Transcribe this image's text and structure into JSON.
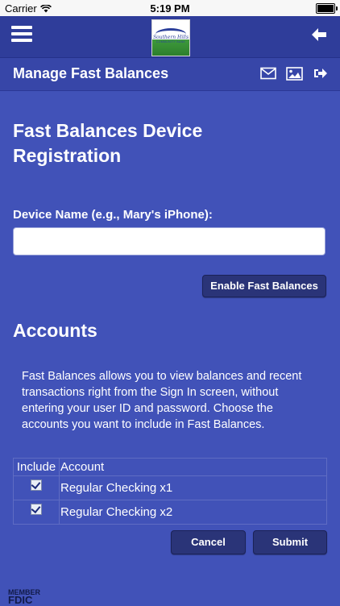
{
  "status_bar": {
    "carrier": "Carrier",
    "time": "5:19 PM"
  },
  "nav": {
    "logo": {
      "name": "Southern Hills",
      "sub": "COMMUNITY BANK"
    }
  },
  "title_bar": {
    "title": "Manage Fast Balances"
  },
  "registration": {
    "heading": "Fast Balances Device Registration",
    "device_label": "Device Name (e.g., Mary's iPhone):",
    "device_value": "",
    "enable_button": "Enable Fast Balances"
  },
  "accounts": {
    "heading": "Accounts",
    "description": "Fast Balances allows you to view balances and recent transactions right from the Sign In screen, without entering your user ID and password. Choose the accounts you want to include in Fast Balances.",
    "columns": {
      "include": "Include",
      "account": "Account"
    },
    "rows": [
      {
        "account": "Regular Checking x1",
        "checked": true
      },
      {
        "account": "Regular Checking x2",
        "checked": true
      }
    ],
    "cancel_button": "Cancel",
    "submit_button": "Submit"
  },
  "footer": {
    "fdic_line1": "MEMBER",
    "fdic_line2": "FDIC"
  },
  "colors": {
    "background": "#4152b8",
    "nav_bar": "#2f3d9a",
    "title_bar": "#3746a8",
    "button": "#2a3478",
    "logo_green": "#3e9a3c"
  }
}
